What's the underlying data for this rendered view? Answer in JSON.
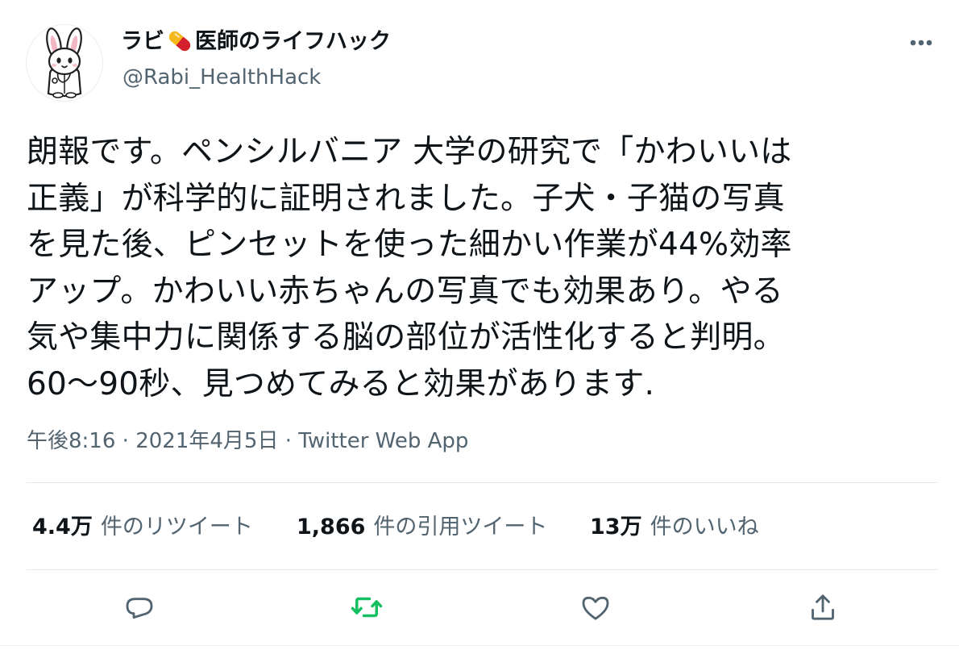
{
  "author": {
    "name_prefix": "ラビ",
    "name_suffix": "医師のライフハック",
    "handle": "@Rabi_HealthHack"
  },
  "tweet": {
    "text": "朗報です。ペンシルバニア 大学の研究で「かわいいは\n正義」が科学的に証明されました。子犬・子猫の写真\nを見た後、ピンセットを使った細かい作業が44%効率\nアップ。かわいい赤ちゃんの写真でも効果あり。やる\n気や集中力に関係する脳の部位が活性化すると判明。\n60〜90秒、見つめてみると効果があります.",
    "time": "午後8:16",
    "separator": "·",
    "date": "2021年4月5日",
    "source": "Twitter Web App"
  },
  "stats": {
    "retweets_count": "4.4万",
    "retweets_label": "件のリツイート",
    "quotes_count": "1,866",
    "quotes_label": "件の引用ツイート",
    "likes_count": "13万",
    "likes_label": "件のいいね"
  },
  "icons": {
    "more": "more-dots-icon",
    "reply": "reply-bubble-icon",
    "retweet": "retweet-arrows-icon",
    "like": "heart-outline-icon",
    "share": "share-upload-icon",
    "name_emoji": "pill-emoji-icon"
  },
  "colors": {
    "text_primary": "#0f1419",
    "text_secondary": "#536471",
    "icon_gray": "#536471",
    "retweet_green": "#17bf63",
    "divider": "#e5e9eb",
    "pill_red": "#d4202c",
    "pill_yellow": "#f5b81c"
  }
}
